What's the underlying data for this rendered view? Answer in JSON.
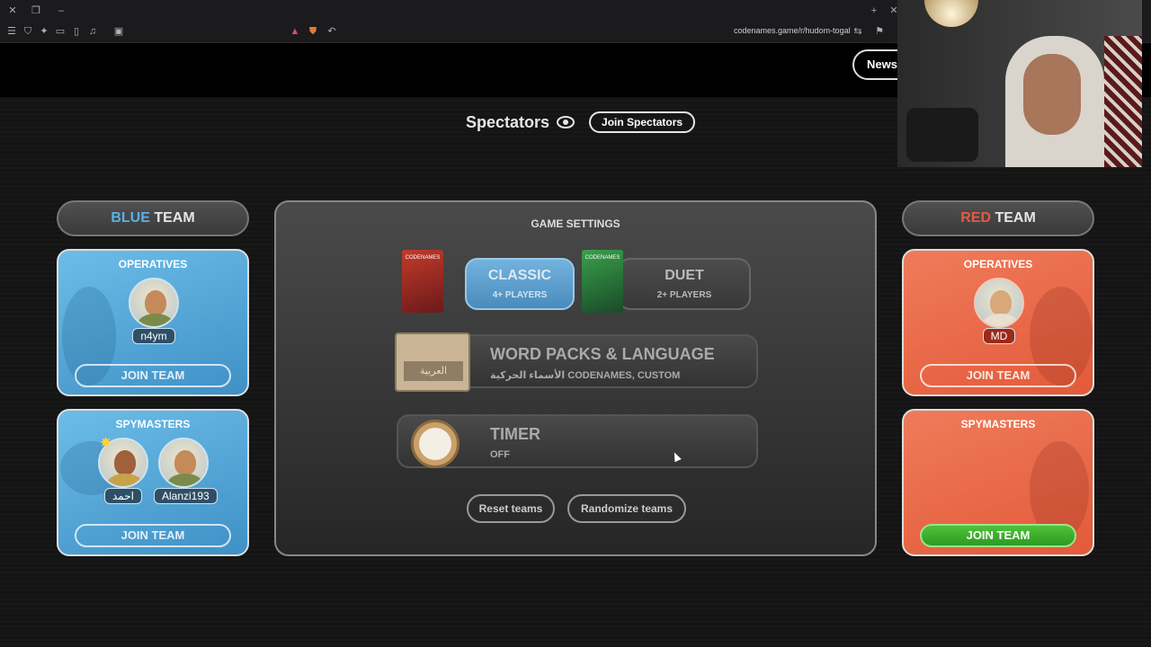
{
  "browser": {
    "url": "codenames.game/r/hudom-togal"
  },
  "header": {
    "news_label": "News"
  },
  "spectators": {
    "title": "Spectators",
    "join_label": "Join Spectators"
  },
  "blue_team": {
    "title_colored": "BLUE",
    "title_rest": " TEAM",
    "color": "#5ab0e6",
    "operatives": {
      "title": "OPERATIVES",
      "players": [
        "n4ym"
      ],
      "join_label": "JOIN TEAM"
    },
    "spymasters": {
      "title": "SPYMASTERS",
      "players": [
        "احمد",
        "Alanzi193"
      ],
      "join_label": "JOIN TEAM"
    }
  },
  "red_team": {
    "title_colored": "RED",
    "title_rest": " TEAM",
    "color": "#e85a40",
    "operatives": {
      "title": "OPERATIVES",
      "players": [
        "MD"
      ],
      "join_label": "JOIN TEAM"
    },
    "spymasters": {
      "title": "SPYMASTERS",
      "players": [],
      "join_label": "JOIN TEAM"
    }
  },
  "settings": {
    "title": "GAME SETTINGS",
    "modes": [
      {
        "label": "CLASSIC",
        "sub": "4+ PLAYERS",
        "selected": true
      },
      {
        "label": "DUET",
        "sub": "2+ PLAYERS",
        "selected": false
      }
    ],
    "box_art_text": [
      "CODENAMES",
      "CODENAMES"
    ],
    "word_packs": {
      "title": "WORD PACKS & LANGUAGE",
      "sub": "الأسماء الحركية CODENAMES, CUSTOM",
      "tile_text": "العربية"
    },
    "timer": {
      "title": "TIMER",
      "sub": "OFF"
    },
    "reset_label": "Reset teams",
    "randomize_label": "Randomize teams"
  }
}
